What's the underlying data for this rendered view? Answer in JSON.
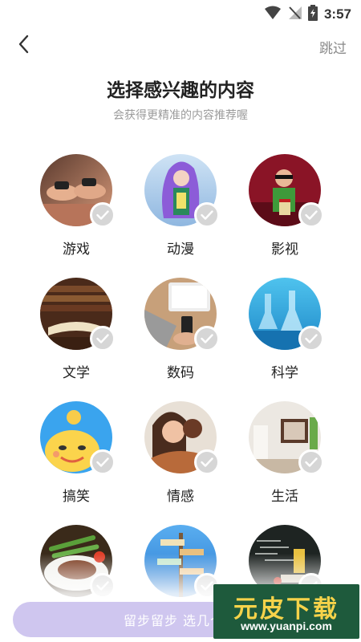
{
  "status_bar": {
    "time": "3:57",
    "icons": [
      "wifi-icon",
      "signal-icon",
      "battery-icon"
    ]
  },
  "header": {
    "back_icon": "chevron-left-icon",
    "skip_label": "跳过"
  },
  "title": "选择感兴趣的内容",
  "subtitle": "会获得更精准的内容推荐喔",
  "categories": [
    {
      "label": "游戏",
      "selected": false
    },
    {
      "label": "动漫",
      "selected": false
    },
    {
      "label": "影视",
      "selected": false
    },
    {
      "label": "文学",
      "selected": false
    },
    {
      "label": "数码",
      "selected": false
    },
    {
      "label": "科学",
      "selected": false
    },
    {
      "label": "搞笑",
      "selected": false
    },
    {
      "label": "情感",
      "selected": false
    },
    {
      "label": "生活",
      "selected": false
    },
    {
      "label": "",
      "selected": false
    },
    {
      "label": "",
      "selected": false
    },
    {
      "label": "",
      "selected": false
    }
  ],
  "cta": {
    "label": "留步留步 选几个兴"
  },
  "watermark": {
    "main": "元皮下载",
    "url": "www.yuanpi.com"
  },
  "colors": {
    "cta_background": "#cfc6ef",
    "check_background": "#d6d6d6",
    "watermark_background": "#1e5a3c",
    "watermark_text": "#f6d34a"
  }
}
